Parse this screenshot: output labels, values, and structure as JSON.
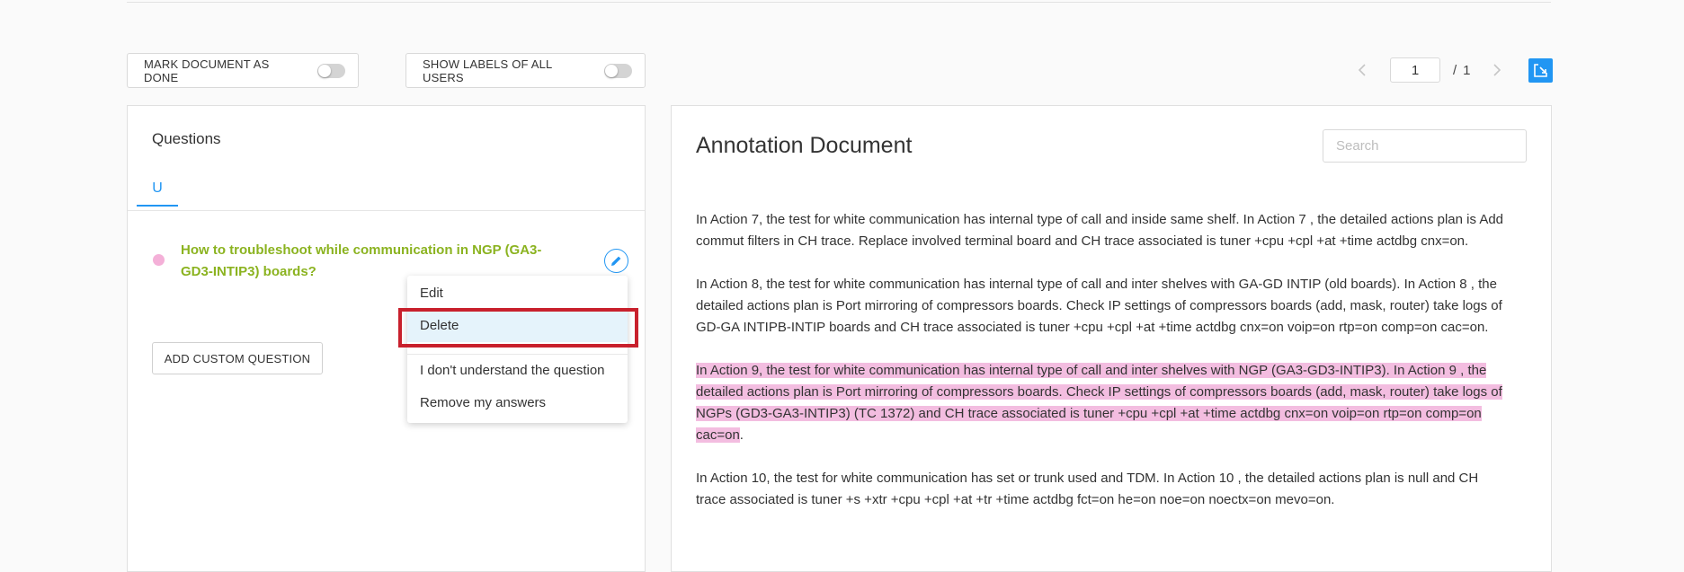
{
  "toolbar": {
    "mark_done_label": "MARK DOCUMENT AS DONE",
    "show_labels_label": "SHOW LABELS OF ALL USERS"
  },
  "pagination": {
    "current_page": "1",
    "separator": "/",
    "total_pages": "1",
    "prev_icon": "chevron-left-icon",
    "next_icon": "chevron-right-icon",
    "fit_icon": "fit-to-page-icon"
  },
  "questions_panel": {
    "title": "Questions",
    "tab_label": "U",
    "question_text": "How to troubleshoot while communication in NGP (GA3-GD3-INTIP3) boards?",
    "question_color": "#8bb320",
    "dot_color": "#f4b0d8",
    "add_custom_label": "ADD CUSTOM QUESTION"
  },
  "context_menu": {
    "edit": "Edit",
    "delete": "Delete",
    "dont_understand": "I don't understand the question",
    "remove_answers": "Remove my answers"
  },
  "document": {
    "title": "Annotation Document",
    "search_placeholder": "Search",
    "paragraph_1": "In Action 7, the test for white communication has internal type of call and inside same shelf. In Action 7 , the detailed actions plan is Add commut filters in CH trace. Replace involved terminal board and CH trace associated is tuner +cpu +cpl +at +time actdbg cnx=on.",
    "paragraph_2": "In Action 8, the test for white communication has internal type of call and inter shelves with GA-GD INTIP (old boards). In Action 8 , the detailed actions plan is Port mirroring of compressors boards. Check IP settings of compressors boards (add, mask, router) take logs of GD-GA INTIPB-INTIP boards and CH trace associated is tuner +cpu +cpl +at +time actdbg cnx=on voip=on rtp=on comp=on cac=on.",
    "paragraph_3_highlight": "In Action 9, the test for white communication has internal type of call and inter shelves with NGP (GA3-GD3-INTIP3). In Action 9 , the detailed actions plan is Port mirroring of compressors boards. Check IP settings of compressors boards (add, mask, router) take logs of NGPs (GD3-GA3-INTIP3) (TC 1372) and CH trace associated is tuner +cpu +cpl +at +time actdbg cnx=on voip=on rtp=on comp=on cac=on",
    "paragraph_3_tail": ".",
    "paragraph_4": "In Action 10, the test for white communication has set or trunk used and TDM. In Action 10 , the detailed actions plan is null and CH trace associated is tuner +s +xtr +cpu +cpl +at +tr +time actdbg fct=on he=on noe=on noectx=on mevo=on.",
    "highlight_color": "#f3bde0"
  },
  "colors": {
    "accent": "#2196f3",
    "selection_outline": "#c8202c",
    "menu_selected_bg": "#e5f3fb"
  }
}
